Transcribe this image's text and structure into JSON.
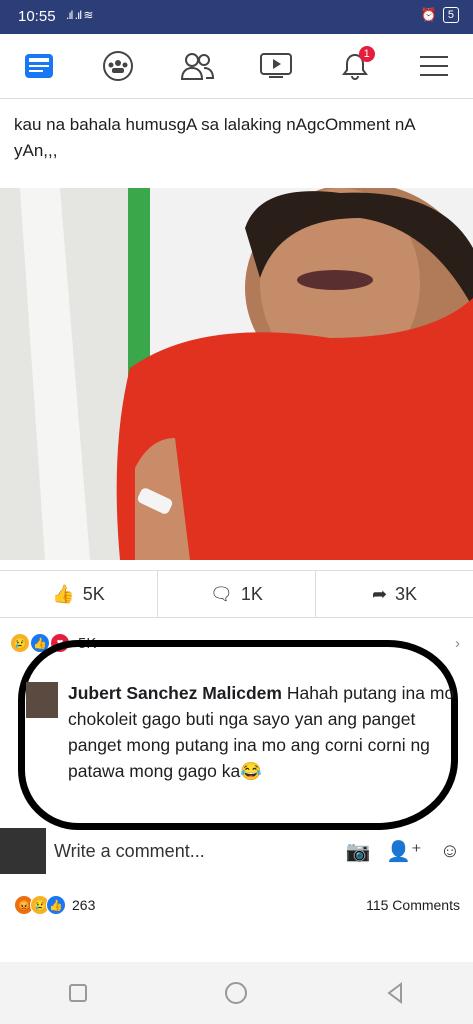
{
  "status": {
    "time": "10:55",
    "battery": "5"
  },
  "nav": {
    "notif_badge": "1"
  },
  "post": {
    "caption": "kau na bahala humusgA sa lalaking nAgcOmment nA yAn,,,"
  },
  "actions": {
    "likes": "5K",
    "comments": "1K",
    "shares": "3K"
  },
  "reactions": {
    "count": "5K"
  },
  "comment": {
    "author": "Jubert Sanchez Malicdem",
    "text": " Hahah putang ina mo chokoleit gago buti nga sayo yan ang panget panget mong putang ina mo ang corni corni ng patawa mong gago ka😂"
  },
  "write": {
    "placeholder": "Write a comment..."
  },
  "bottom": {
    "reaction_count": "263",
    "comments": "115 Comments"
  },
  "icons": [
    "news-feed-icon",
    "groups-icon",
    "friends-icon",
    "watch-icon",
    "notifications-icon",
    "menu-icon",
    "like-icon",
    "comment-icon",
    "share-icon",
    "camera-icon",
    "sticker-icon",
    "emoji-icon",
    "back-icon",
    "home-icon",
    "recents-icon"
  ]
}
